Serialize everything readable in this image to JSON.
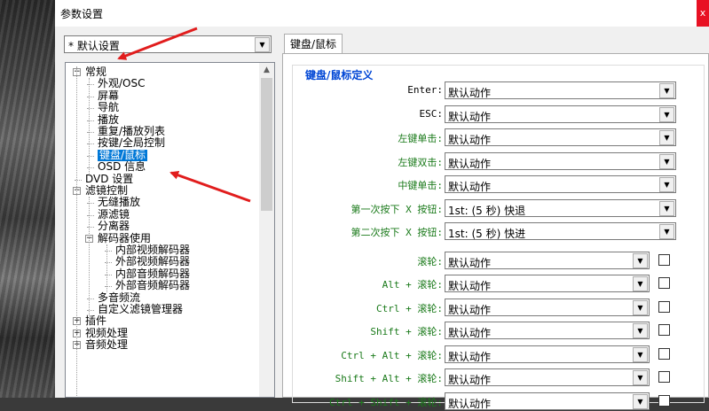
{
  "window": {
    "title": "参数设置",
    "close_label": "x"
  },
  "profile_combo": {
    "value": "* 默认设置"
  },
  "tree": {
    "items": [
      {
        "label": "常规",
        "level": 0,
        "expander": "−"
      },
      {
        "label": "外观/OSC",
        "level": 1
      },
      {
        "label": "屏幕",
        "level": 1
      },
      {
        "label": "导航",
        "level": 1
      },
      {
        "label": "播放",
        "level": 1
      },
      {
        "label": "重复/播放列表",
        "level": 1
      },
      {
        "label": "按键/全局控制",
        "level": 1
      },
      {
        "label": "键盘/鼠标",
        "level": 1,
        "selected": true
      },
      {
        "label": "OSD 信息",
        "level": 1
      },
      {
        "label": "DVD 设置",
        "level": 0
      },
      {
        "label": "滤镜控制",
        "level": 0,
        "expander": "−"
      },
      {
        "label": "无缝播放",
        "level": 1
      },
      {
        "label": "源滤镜",
        "level": 1
      },
      {
        "label": "分离器",
        "level": 1
      },
      {
        "label": "解码器使用",
        "level": 1,
        "expander": "−"
      },
      {
        "label": "内部视频解码器",
        "level": 2
      },
      {
        "label": "外部视频解码器",
        "level": 2
      },
      {
        "label": "内部音频解码器",
        "level": 2
      },
      {
        "label": "外部音频解码器",
        "level": 2
      },
      {
        "label": "多音频流",
        "level": 1
      },
      {
        "label": "自定义滤镜管理器",
        "level": 1
      },
      {
        "label": "插件",
        "level": 0,
        "expander": "+"
      },
      {
        "label": "视频处理",
        "level": 0,
        "expander": "+"
      },
      {
        "label": "音频处理",
        "level": 0,
        "expander": "+"
      }
    ]
  },
  "tab": {
    "label": "键盘/鼠标"
  },
  "group": {
    "title": "键盘/鼠标定义"
  },
  "fields": [
    {
      "label": "Enter:",
      "value": "默认动作",
      "green": false,
      "checkbox": false
    },
    {
      "label": "ESC:",
      "value": "默认动作",
      "green": false,
      "checkbox": false
    },
    {
      "label": "左键单击:",
      "value": "默认动作",
      "green": true,
      "checkbox": false
    },
    {
      "label": "左键双击:",
      "value": "默认动作",
      "green": true,
      "checkbox": false
    },
    {
      "label": "中键单击:",
      "value": "默认动作",
      "green": true,
      "checkbox": false
    },
    {
      "label": "第一次按下 X 按钮:",
      "value": "1st: (5 秒) 快退",
      "green": true,
      "checkbox": false
    },
    {
      "label": "第二次按下 X 按钮:",
      "value": "1st: (5 秒) 快进",
      "green": true,
      "checkbox": false
    },
    {
      "label": "滚轮:",
      "value": "默认动作",
      "green": true,
      "checkbox": true
    },
    {
      "label": "Alt + 滚轮:",
      "value": "默认动作",
      "green": true,
      "checkbox": true
    },
    {
      "label": "Ctrl + 滚轮:",
      "value": "默认动作",
      "green": true,
      "checkbox": true
    },
    {
      "label": "Shift + 滚轮:",
      "value": "默认动作",
      "green": true,
      "checkbox": true
    },
    {
      "label": "Ctrl + Alt + 滚轮:",
      "value": "默认动作",
      "green": true,
      "checkbox": true
    },
    {
      "label": "Shift + Alt + 滚轮:",
      "value": "默认动作",
      "green": true,
      "checkbox": true
    },
    {
      "label": "Ctrl + Shift + 滚轮:",
      "value": "默认动作",
      "green": true,
      "checkbox": true
    }
  ],
  "colors": {
    "annotation_arrow": "#e11d1d",
    "selection": "#0078d7",
    "field_label_green": "#1a7a1a",
    "group_title_blue": "#0046d5"
  }
}
